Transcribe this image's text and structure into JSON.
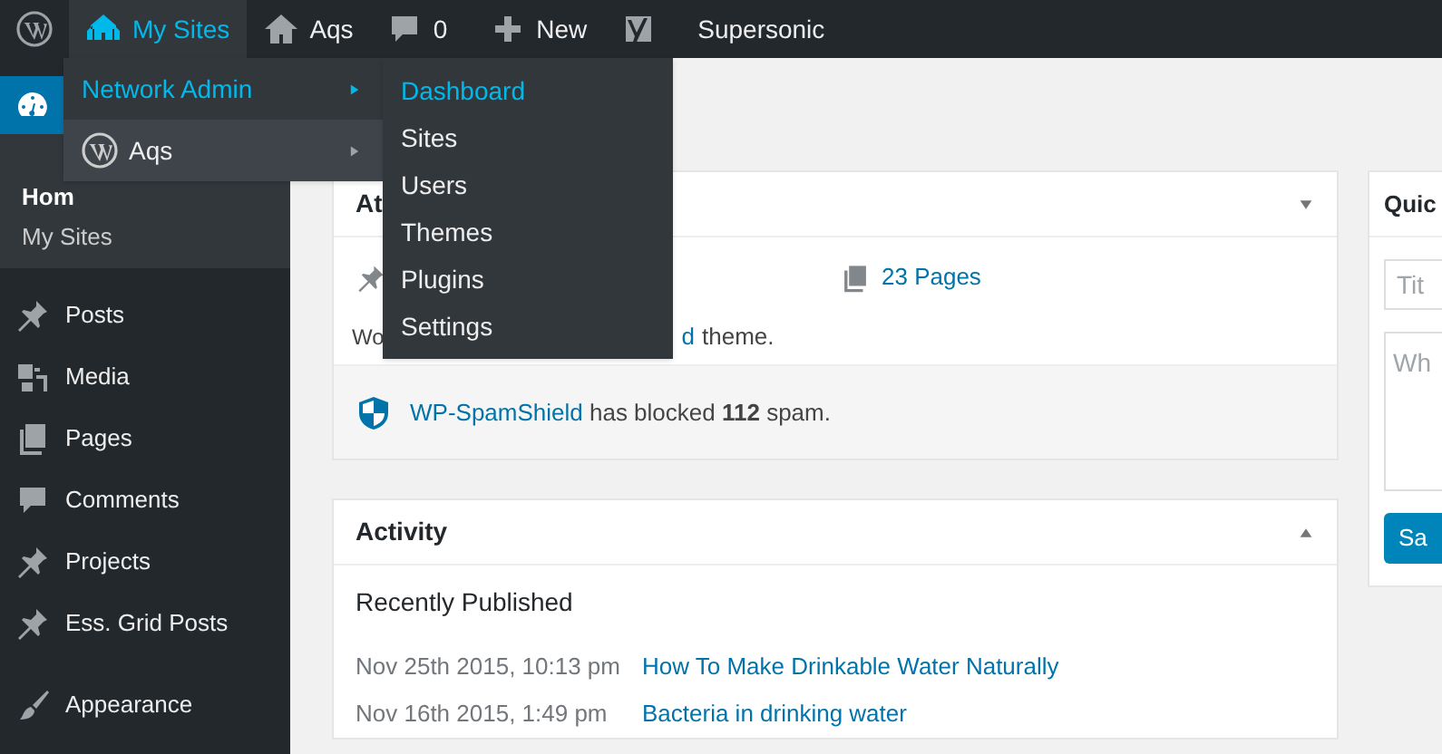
{
  "admin_bar": {
    "items": [
      {
        "kind": "wp",
        "selected": false
      },
      {
        "kind": "sites",
        "label": "My Sites",
        "selected": true
      },
      {
        "kind": "home",
        "label": "Aqs",
        "selected": false
      },
      {
        "kind": "comments",
        "label": "0",
        "selected": false
      },
      {
        "kind": "new",
        "label": "New",
        "selected": false
      },
      {
        "kind": "seo",
        "selected": false
      },
      {
        "kind": "text",
        "label": "Supersonic",
        "selected": false
      }
    ]
  },
  "sites_menu": {
    "items": [
      {
        "kind": "network",
        "label": "Network Admin",
        "selected": true
      },
      {
        "kind": "site",
        "label": "Aqs",
        "selected": false
      }
    ],
    "submenu": [
      {
        "label": "Dashboard",
        "selected": true
      },
      {
        "label": "Sites",
        "selected": false
      },
      {
        "label": "Users",
        "selected": false
      },
      {
        "label": "Themes",
        "selected": false
      },
      {
        "label": "Plugins",
        "selected": false
      },
      {
        "label": "Settings",
        "selected": false
      }
    ]
  },
  "sidebar": {
    "items": [
      {
        "kind": "dashboard",
        "selected": true,
        "children": [
          {
            "label": "Hom",
            "selected": true
          },
          {
            "label": "My Sites",
            "selected": false
          }
        ]
      },
      {
        "kind": "pin",
        "label": "Posts",
        "selected": false
      },
      {
        "kind": "media",
        "label": "Media",
        "selected": false
      },
      {
        "kind": "pages",
        "label": "Pages",
        "selected": false
      },
      {
        "kind": "comments",
        "label": "Comments",
        "selected": false
      },
      {
        "kind": "pin",
        "label": "Projects",
        "selected": false
      },
      {
        "kind": "pin",
        "label": "Ess. Grid Posts",
        "selected": false
      },
      {
        "kind": "brush",
        "label": "Appearance",
        "selected": false
      }
    ]
  },
  "glance": {
    "title": "At",
    "expanded": true,
    "pages": "23 Pages",
    "theme_text_start": "Wo",
    "theme_link_end": "d",
    "theme_text_end": "theme.",
    "spam_link": "WP-SpamShield",
    "spam_text": "has blocked **112** spam."
  },
  "activity": {
    "title": "Activity",
    "expanded": false,
    "heading": "Recently Published",
    "rows": [
      {
        "date": "Nov 25th 2015, 10:13 pm",
        "title": "How To Make Drinkable Water Naturally"
      },
      {
        "date": "Nov 16th 2015, 1:49 pm",
        "title": "Bacteria in drinking water"
      }
    ]
  },
  "quick_draft": {
    "title": "Quic",
    "title_placeholder": "Tit",
    "content_placeholder": "Wh",
    "button": "Sa"
  }
}
